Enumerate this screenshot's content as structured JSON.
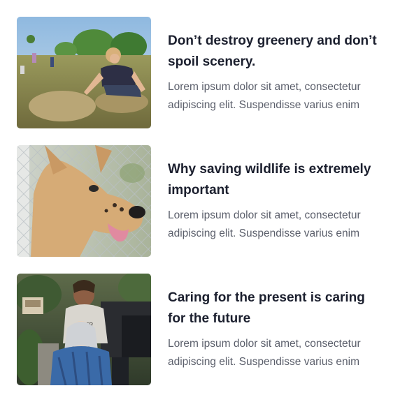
{
  "posts": [
    {
      "title": "Don’t destroy greenery and don’t spoil scenery.",
      "excerpt": "Lorem ipsum dolor sit amet, consectetur adipiscing elit. Suspendisse varius enim",
      "image": "volunteers-planting-photo"
    },
    {
      "title": "Why saving wildlife is extremely important",
      "excerpt": "Lorem ipsum dolor sit amet, consectetur adipiscing elit. Suspendisse varius enim",
      "image": "dog-at-fence-photo"
    },
    {
      "title": "Caring for the present is caring for the future",
      "excerpt": "Lorem ipsum dolor sit amet, consectetur adipiscing elit. Suspendisse varius enim",
      "image": "caregiver-wheelchair-photo"
    }
  ],
  "colors": {
    "title": "#1b1f2e",
    "excerpt": "#5b5f6b",
    "background": "#ffffff"
  }
}
